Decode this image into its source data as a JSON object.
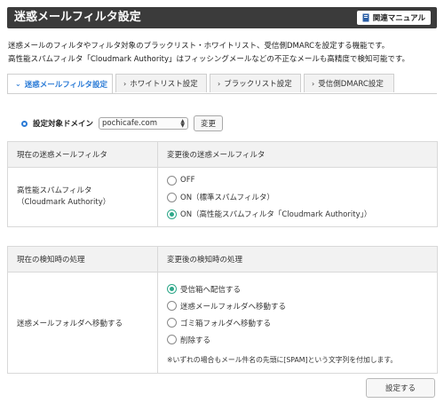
{
  "header": {
    "title": "迷惑メールフィルタ設定",
    "manual_label": "関連マニュアル"
  },
  "description": {
    "line1": "迷惑メールのフィルタやフィルタ対象のブラックリスト・ホワイトリスト、受信側DMARCを設定する機能です。",
    "line2": "高性能スパムフィルタ「Cloudmark Authority」はフィッシングメールなどの不正なメールも高精度で検知可能です。"
  },
  "tabs": [
    {
      "label": "迷惑メールフィルタ設定",
      "active": true
    },
    {
      "label": "ホワイトリスト設定",
      "active": false
    },
    {
      "label": "ブラックリスト設定",
      "active": false
    },
    {
      "label": "受信側DMARC設定",
      "active": false
    }
  ],
  "domain": {
    "label": "設定対象ドメイン",
    "selected": "pochicafe.com",
    "change_button": "変更"
  },
  "filter_table": {
    "col_current": "現在の迷惑メールフィルタ",
    "col_new": "変更後の迷惑メールフィルタ",
    "current_value_line1": "高性能スパムフィルタ",
    "current_value_line2": "（Cloudmark Authority）",
    "options": [
      {
        "label": "OFF",
        "selected": false
      },
      {
        "label": "ON（標準スパムフィルタ）",
        "selected": false
      },
      {
        "label": "ON（高性能スパムフィルタ「Cloudmark Authority」）",
        "selected": true
      }
    ]
  },
  "action_table": {
    "col_current": "現在の検知時の処理",
    "col_new": "変更後の検知時の処理",
    "current_value": "迷惑メールフォルダへ移動する",
    "options": [
      {
        "label": "受信箱へ配信する",
        "selected": true
      },
      {
        "label": "迷惑メールフォルダへ移動する",
        "selected": false
      },
      {
        "label": "ゴミ箱フォルダへ移動する",
        "selected": false
      },
      {
        "label": "削除する",
        "selected": false
      }
    ],
    "note": "※いずれの場合もメール件名の先頭に[SPAM]という文字列を付加します。"
  },
  "submit_label": "設定する",
  "colors": {
    "header_bg": "#3b3b3b",
    "accent": "#2b7bd6",
    "radio_on": "#2fa88a"
  }
}
